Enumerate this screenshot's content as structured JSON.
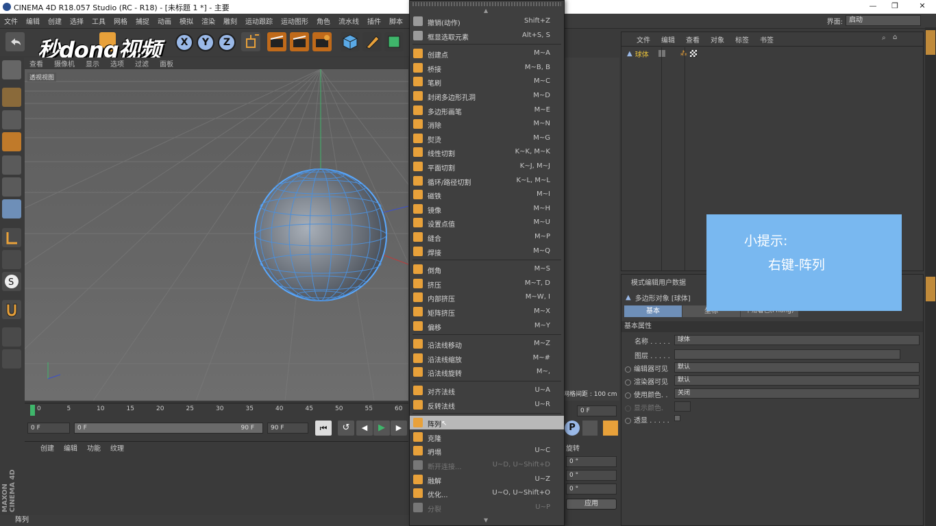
{
  "window": {
    "title": "CINEMA 4D R18.057 Studio (RC - R18) - [未标题 1 *] - 主要"
  },
  "menubar": [
    "文件",
    "编辑",
    "创建",
    "选择",
    "工具",
    "网格",
    "捕捉",
    "动画",
    "模拟",
    "渲染",
    "雕刻",
    "运动跟踪",
    "运动图形",
    "角色",
    "流水线",
    "插件",
    "脚本"
  ],
  "layout": {
    "label": "界面:",
    "value": "启动"
  },
  "watermark": "秒dong视频",
  "axes": {
    "x": "X",
    "y": "Y",
    "z": "Z"
  },
  "viewport": {
    "menu": [
      "查看",
      "摄像机",
      "显示",
      "选项",
      "过滤",
      "面板"
    ],
    "label": "透视视图",
    "grid_distance": "网格间距 : 100 cm"
  },
  "timeline": {
    "ticks": [
      "0",
      "5",
      "10",
      "15",
      "20",
      "25",
      "30",
      "35",
      "40",
      "45",
      "50",
      "55",
      "60"
    ],
    "start": "0 F",
    "range_start": "0 F",
    "range_end": "90 F",
    "end": "90 F",
    "current": "0 F"
  },
  "material": {
    "menu": [
      "创建",
      "编辑",
      "功能",
      "纹理"
    ]
  },
  "status": "阵列",
  "maxon": "MAXON CINEMA 4D",
  "objects": {
    "menu": [
      "文件",
      "编辑",
      "查看",
      "对象",
      "标签",
      "书签"
    ],
    "items": [
      {
        "name": "球体"
      }
    ]
  },
  "attributes": {
    "menu": [
      "模式",
      "编辑",
      "用户数据"
    ],
    "object_title": "多边形对象 [球体]",
    "tabs": [
      "基本",
      "坐标",
      "平滑着色(Phong)"
    ],
    "section": "基本属性",
    "rows": [
      {
        "label": "名称 . . . . .",
        "value": "球体"
      },
      {
        "label": "图层 . . . . .",
        "value": ""
      },
      {
        "label": "编辑器可见",
        "value": "默认"
      },
      {
        "label": "渲染器可见",
        "value": "默认"
      },
      {
        "label": "使用颜色. .",
        "value": "关闭"
      },
      {
        "label": "显示颜色.",
        "value": ""
      },
      {
        "label": "透显 . . . . .",
        "value": ""
      }
    ]
  },
  "coords": {
    "header": "旋转",
    "values": [
      "0 °",
      "0 °",
      "0 °"
    ],
    "apply": "应用"
  },
  "context_menu": [
    {
      "label": "撤销(动作)",
      "shortcut": "Shift+Z",
      "color": "#9a9a9a"
    },
    {
      "label": "框显选取元素",
      "shortcut": "Alt+S, S",
      "color": "#9a9a9a"
    },
    {
      "sep": true
    },
    {
      "label": "创建点",
      "shortcut": "M~A",
      "color": "#e8a13a"
    },
    {
      "label": "桥接",
      "shortcut": "M~B, B",
      "color": "#e8a13a"
    },
    {
      "label": "笔刷",
      "shortcut": "M~C",
      "color": "#e8a13a"
    },
    {
      "label": "封闭多边形孔洞",
      "shortcut": "M~D",
      "color": "#e8a13a"
    },
    {
      "label": "多边形画笔",
      "shortcut": "M~E",
      "color": "#e8a13a"
    },
    {
      "label": "消除",
      "shortcut": "M~N",
      "color": "#e8a13a"
    },
    {
      "label": "熨烫",
      "shortcut": "M~G",
      "color": "#e8a13a"
    },
    {
      "label": "线性切割",
      "shortcut": "K~K, M~K",
      "color": "#e8a13a"
    },
    {
      "label": "平面切割",
      "shortcut": "K~J, M~J",
      "color": "#e8a13a"
    },
    {
      "label": "循环/路径切割",
      "shortcut": "K~L, M~L",
      "color": "#e8a13a"
    },
    {
      "label": "磁铁",
      "shortcut": "M~I",
      "color": "#e8a13a"
    },
    {
      "label": "镜像",
      "shortcut": "M~H",
      "color": "#e8a13a"
    },
    {
      "label": "设置点值",
      "shortcut": "M~U",
      "color": "#e8a13a"
    },
    {
      "label": "缝合",
      "shortcut": "M~P",
      "color": "#e8a13a"
    },
    {
      "label": "焊接",
      "shortcut": "M~Q",
      "color": "#e8a13a"
    },
    {
      "sep": true
    },
    {
      "label": "倒角",
      "shortcut": "M~S",
      "color": "#e8a13a"
    },
    {
      "label": "挤压",
      "shortcut": "M~T, D",
      "color": "#e8a13a"
    },
    {
      "label": "内部挤压",
      "shortcut": "M~W, I",
      "color": "#e8a13a"
    },
    {
      "label": "矩阵挤压",
      "shortcut": "M~X",
      "color": "#e8a13a"
    },
    {
      "label": "偏移",
      "shortcut": "M~Y",
      "color": "#e8a13a"
    },
    {
      "sep": true
    },
    {
      "label": "沿法线移动",
      "shortcut": "M~Z",
      "color": "#e8a13a"
    },
    {
      "label": "沿法线缩放",
      "shortcut": "M~#",
      "color": "#e8a13a"
    },
    {
      "label": "沿法线旋转",
      "shortcut": "M~,",
      "color": "#e8a13a"
    },
    {
      "sep": true
    },
    {
      "label": "对齐法线",
      "shortcut": "U~A",
      "color": "#e8a13a"
    },
    {
      "label": "反转法线",
      "shortcut": "U~R",
      "color": "#e8a13a"
    },
    {
      "sep": true
    },
    {
      "label": "阵列",
      "shortcut": "",
      "color": "#e8a13a",
      "highlight": true
    },
    {
      "label": "克隆",
      "shortcut": "",
      "color": "#e8a13a"
    },
    {
      "label": "坍塌",
      "shortcut": "U~C",
      "color": "#e8a13a"
    },
    {
      "label": "断开连接...",
      "shortcut": "U~D, U~Shift+D",
      "color": "#777",
      "disabled": true
    },
    {
      "label": "融解",
      "shortcut": "U~Z",
      "color": "#e8a13a"
    },
    {
      "label": "优化...",
      "shortcut": "U~O, U~Shift+O",
      "color": "#e8a13a"
    },
    {
      "label": "分裂",
      "shortcut": "U~P",
      "color": "#777",
      "disabled": true
    }
  ],
  "tip": {
    "line1": "小提示:",
    "line2": "右键-阵列"
  }
}
